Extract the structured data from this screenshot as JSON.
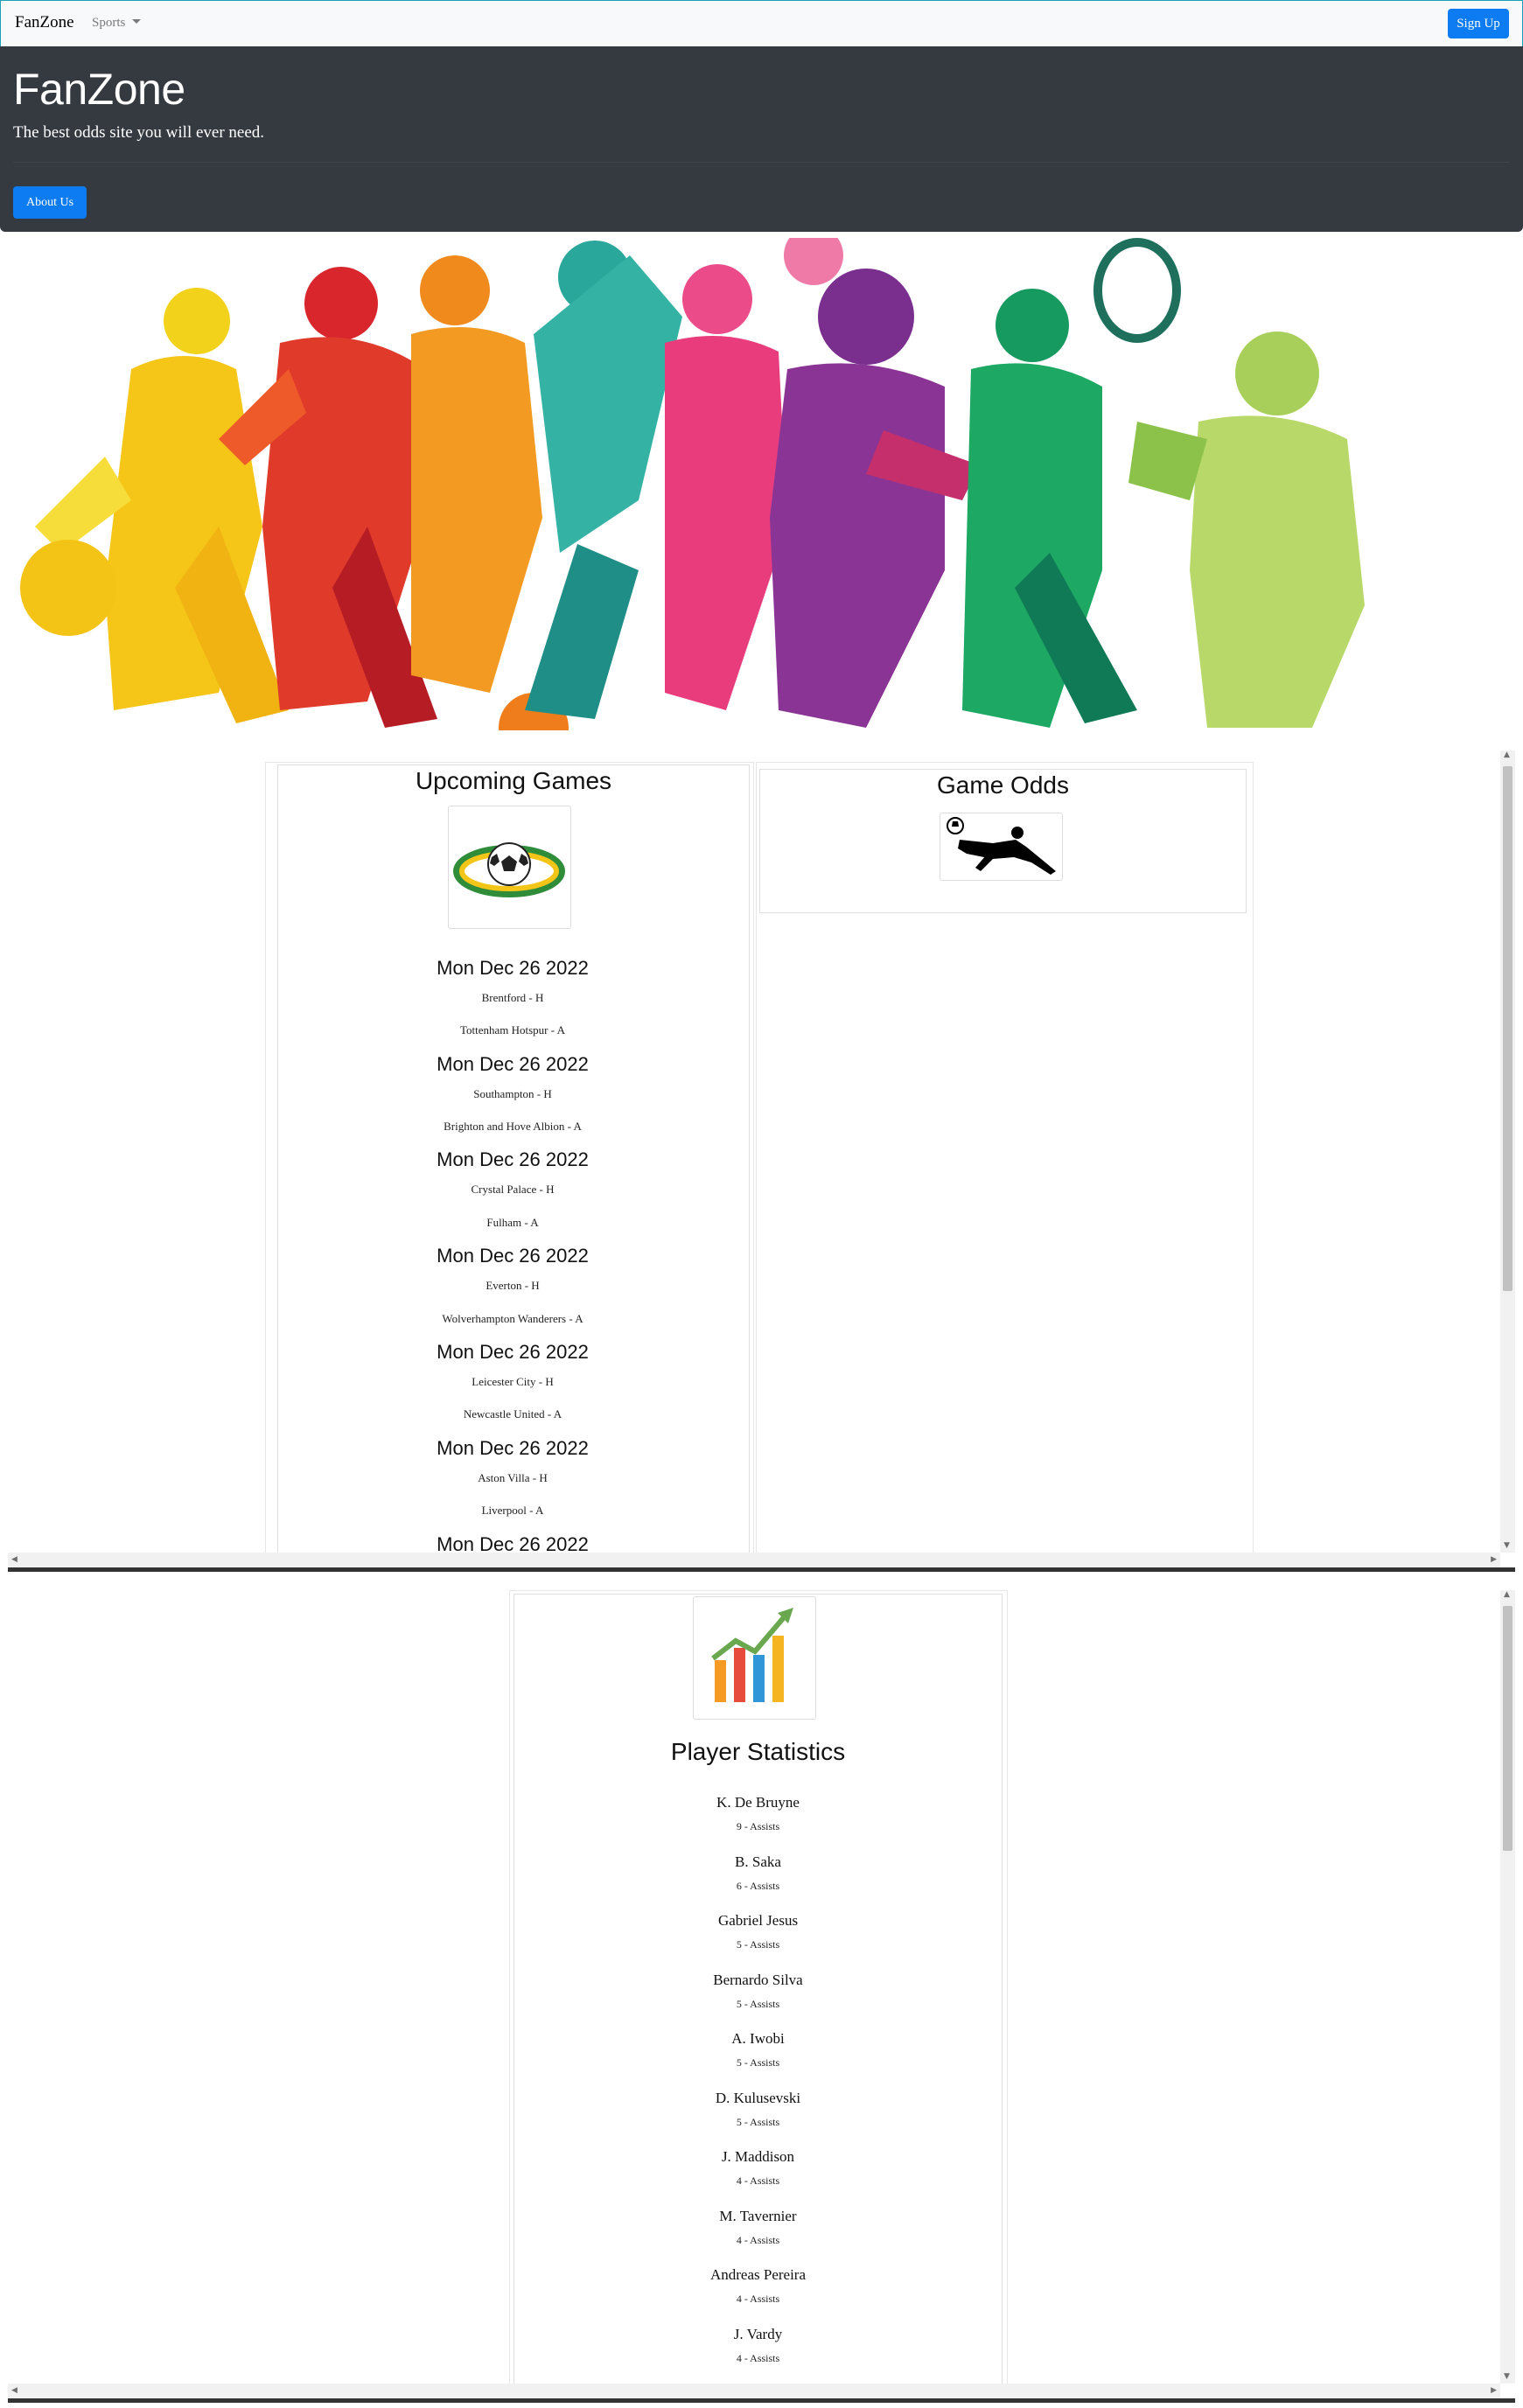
{
  "navbar": {
    "brand": "FanZone",
    "sports_label": "Sports",
    "signup_label": "Sign Up"
  },
  "jumbotron": {
    "title": "FanZone",
    "lead": "The best odds site you will ever need.",
    "about_label": "About Us"
  },
  "upcoming": {
    "title": "Upcoming Games",
    "games": [
      {
        "date": "Mon Dec 26 2022",
        "home": "Brentford - H",
        "away": "Tottenham Hotspur - A"
      },
      {
        "date": "Mon Dec 26 2022",
        "home": "Southampton - H",
        "away": "Brighton and Hove Albion - A"
      },
      {
        "date": "Mon Dec 26 2022",
        "home": "Crystal Palace - H",
        "away": "Fulham - A"
      },
      {
        "date": "Mon Dec 26 2022",
        "home": "Everton - H",
        "away": "Wolverhampton Wanderers - A"
      },
      {
        "date": "Mon Dec 26 2022",
        "home": "Leicester City - H",
        "away": "Newcastle United - A"
      },
      {
        "date": "Mon Dec 26 2022",
        "home": "Aston Villa - H",
        "away": "Liverpool - A"
      },
      {
        "date": "Mon Dec 26 2022"
      }
    ]
  },
  "odds": {
    "title": "Game Odds"
  },
  "stats": {
    "title": "Player Statistics",
    "players": [
      {
        "name": "K. De Bruyne",
        "stat": "9 - Assists"
      },
      {
        "name": "B. Saka",
        "stat": "6 - Assists"
      },
      {
        "name": "Gabriel Jesus",
        "stat": "5 - Assists"
      },
      {
        "name": "Bernardo Silva",
        "stat": "5 - Assists"
      },
      {
        "name": "A. Iwobi",
        "stat": "5 - Assists"
      },
      {
        "name": "D. Kulusevski",
        "stat": "5 - Assists"
      },
      {
        "name": "J. Maddison",
        "stat": "4 - Assists"
      },
      {
        "name": "M. Tavernier",
        "stat": "4 - Assists"
      },
      {
        "name": "Andreas Pereira",
        "stat": "4 - Assists"
      },
      {
        "name": "J. Vardy",
        "stat": "4 - Assists"
      }
    ]
  },
  "colors": {
    "primary": "#0d7cf2",
    "jumbotron_bg": "#343a40",
    "navbar_bg": "#f8f9fa"
  },
  "icons": {
    "upcoming": "soccer-ball-icon",
    "odds": "soccer-player-silhouette-icon",
    "stats": "bar-chart-growth-icon"
  }
}
